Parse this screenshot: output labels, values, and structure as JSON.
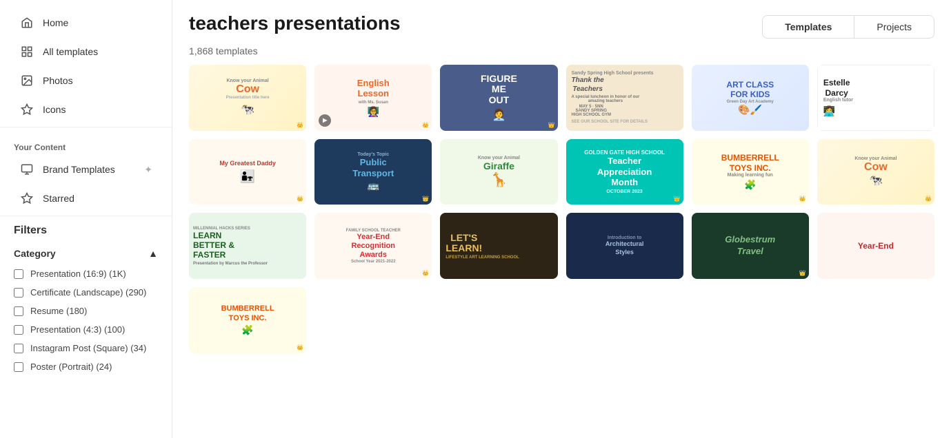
{
  "sidebar": {
    "nav_items": [
      {
        "id": "home",
        "label": "Home",
        "icon": "🏠"
      },
      {
        "id": "all-templates",
        "label": "All templates",
        "icon": "⊞"
      },
      {
        "id": "photos",
        "label": "Photos",
        "icon": "🖼"
      },
      {
        "id": "icons",
        "label": "Icons",
        "icon": "✦"
      }
    ],
    "your_content_title": "Your Content",
    "content_items": [
      {
        "id": "brand-templates",
        "label": "Brand Templates",
        "icon": "🏷"
      },
      {
        "id": "starred",
        "label": "Starred",
        "icon": "☆"
      }
    ],
    "filters_title": "Filters",
    "category_title": "Category",
    "categories": [
      {
        "label": "Presentation (16:9) (1K)"
      },
      {
        "label": "Certificate (Landscape) (290)"
      },
      {
        "label": "Resume (180)"
      },
      {
        "label": "Presentation (4:3) (100)"
      },
      {
        "label": "Instagram Post (Square) (34)"
      },
      {
        "label": "Poster (Portrait) (24)"
      }
    ]
  },
  "header": {
    "title": "teachers presentations",
    "tab_templates": "Templates",
    "tab_projects": "Projects",
    "template_count": "1,868 templates"
  },
  "grid": {
    "cards": [
      {
        "id": "cow1",
        "style": "cow",
        "title": "Cow",
        "sub": "Know your Animal",
        "row": 1
      },
      {
        "id": "english",
        "style": "english",
        "title": "English Lesson",
        "sub": "",
        "row": 1
      },
      {
        "id": "figure",
        "style": "figure",
        "title": "FIGURE ME OUT",
        "sub": "",
        "row": 1
      },
      {
        "id": "thank",
        "style": "thank",
        "title": "Thank the Teachers",
        "sub": "Sandy Spring High School",
        "row": 1
      },
      {
        "id": "artclass",
        "style": "artclass",
        "title": "ART CLASS FOR KIDS",
        "sub": "Green Day Art Academy",
        "row": 1
      },
      {
        "id": "estelle",
        "style": "estelle",
        "title": "Estelle Darcy",
        "sub": "English tutor",
        "row": 2
      },
      {
        "id": "daddy",
        "style": "daddy",
        "title": "My Greatest Daddy",
        "sub": "",
        "row": 2
      },
      {
        "id": "transport",
        "style": "transport",
        "title": "Public Transport",
        "sub": "Today's Topic",
        "row": 2
      },
      {
        "id": "giraffe",
        "style": "giraffe",
        "title": "Giraffe",
        "sub": "Know your Animal",
        "row": 2
      },
      {
        "id": "teacher",
        "style": "teacher",
        "title": "Teacher Appreciation Month",
        "sub": "",
        "row": 3
      },
      {
        "id": "bumberrell1",
        "style": "bumberrell1",
        "title": "BUMBERRELL TOYS INC.",
        "sub": "Making learning fun",
        "row": 3
      },
      {
        "id": "cow2",
        "style": "cow2",
        "title": "Cow",
        "sub": "Know your Animal",
        "row": 3
      },
      {
        "id": "learn",
        "style": "learn",
        "title": "LEARN BETTER & FASTER",
        "sub": "",
        "row": 3
      },
      {
        "id": "yearend1",
        "style": "yearend1",
        "title": "Year-End Recognition Awards",
        "sub": "",
        "row": 3
      },
      {
        "id": "letslearn",
        "style": "letslearn",
        "title": "LET'S LEARN!",
        "sub": "",
        "row": 4
      },
      {
        "id": "arch",
        "style": "arch",
        "title": "Introduction to Architectural Styles",
        "sub": "",
        "row": 4
      },
      {
        "id": "globestrum",
        "style": "globestrum",
        "title": "Globestrum Travel",
        "sub": "",
        "row": 4
      },
      {
        "id": "yearend2",
        "style": "yearend2",
        "title": "Year-End",
        "sub": "",
        "row": 4
      },
      {
        "id": "bumberrell2",
        "style": "bumberrell2",
        "title": "BUMBERRELL TOYS INC.",
        "sub": "",
        "row": 4
      }
    ]
  }
}
